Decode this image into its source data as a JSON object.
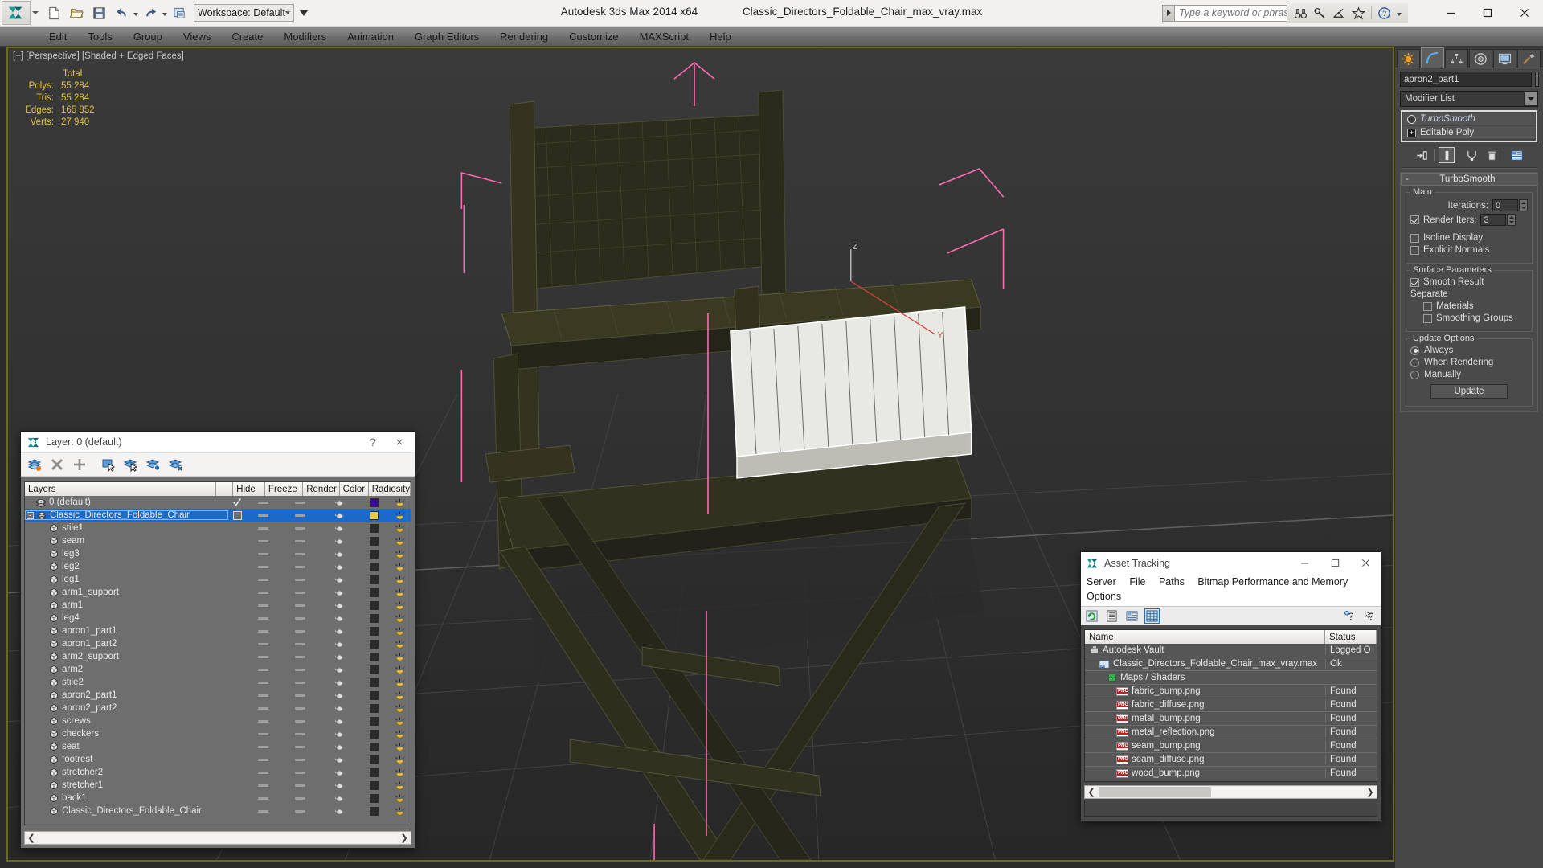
{
  "titlebar": {
    "workspace_label": "Workspace: Default",
    "product": "Autodesk 3ds Max  2014 x64",
    "filename": "Classic_Directors_Foldable_Chair_max_vray.max",
    "search_placeholder": "Type a keyword or phrase"
  },
  "menubar": {
    "items": [
      "Edit",
      "Tools",
      "Group",
      "Views",
      "Create",
      "Modifiers",
      "Animation",
      "Graph Editors",
      "Rendering",
      "Customize",
      "MAXScript",
      "Help"
    ]
  },
  "viewport": {
    "label": "[+] [Perspective] [Shaded + Edged Faces]",
    "stats": {
      "header": "Total",
      "rows": [
        {
          "key": "Polys:",
          "value": "55 284"
        },
        {
          "key": "Tris:",
          "value": "55 284"
        },
        {
          "key": "Edges:",
          "value": "165 852"
        },
        {
          "key": "Verts:",
          "value": "27 940"
        }
      ]
    }
  },
  "layer_dialog": {
    "title": "Layer: 0 (default)",
    "help_label": "?",
    "close_label": "×",
    "columns": [
      "Layers",
      "",
      "Hide",
      "Freeze",
      "Render",
      "Color",
      "Radiosity"
    ],
    "rows": [
      {
        "name": "0 (default)",
        "indent": 0,
        "icon": "layers-icon",
        "check": "tick",
        "color": "#3b0a9b",
        "selected": false
      },
      {
        "name": "Classic_Directors_Foldable_Chair",
        "indent": 0,
        "icon": "layers-icon",
        "check": "box",
        "color": "#e8c84a",
        "selected": true,
        "expander": "minus"
      },
      {
        "name": "stile1",
        "indent": 1,
        "icon": "object-icon",
        "color": "#2b2b2b",
        "selected": false
      },
      {
        "name": "seam",
        "indent": 1,
        "icon": "object-icon",
        "color": "#2b2b2b",
        "selected": false
      },
      {
        "name": "leg3",
        "indent": 1,
        "icon": "object-icon",
        "color": "#2b2b2b",
        "selected": false
      },
      {
        "name": "leg2",
        "indent": 1,
        "icon": "object-icon",
        "color": "#2b2b2b",
        "selected": false
      },
      {
        "name": "leg1",
        "indent": 1,
        "icon": "object-icon",
        "color": "#2b2b2b",
        "selected": false
      },
      {
        "name": "arm1_support",
        "indent": 1,
        "icon": "object-icon",
        "color": "#2b2b2b",
        "selected": false
      },
      {
        "name": "arm1",
        "indent": 1,
        "icon": "object-icon",
        "color": "#2b2b2b",
        "selected": false
      },
      {
        "name": "leg4",
        "indent": 1,
        "icon": "object-icon",
        "color": "#2b2b2b",
        "selected": false
      },
      {
        "name": "apron1_part1",
        "indent": 1,
        "icon": "object-icon",
        "color": "#2b2b2b",
        "selected": false
      },
      {
        "name": "apron1_part2",
        "indent": 1,
        "icon": "object-icon",
        "color": "#2b2b2b",
        "selected": false
      },
      {
        "name": "arm2_support",
        "indent": 1,
        "icon": "object-icon",
        "color": "#2b2b2b",
        "selected": false
      },
      {
        "name": "arm2",
        "indent": 1,
        "icon": "object-icon",
        "color": "#2b2b2b",
        "selected": false
      },
      {
        "name": "stile2",
        "indent": 1,
        "icon": "object-icon",
        "color": "#2b2b2b",
        "selected": false
      },
      {
        "name": "apron2_part1",
        "indent": 1,
        "icon": "object-icon",
        "color": "#2b2b2b",
        "selected": false
      },
      {
        "name": "apron2_part2",
        "indent": 1,
        "icon": "object-icon",
        "color": "#2b2b2b",
        "selected": false
      },
      {
        "name": "screws",
        "indent": 1,
        "icon": "object-icon",
        "color": "#2b2b2b",
        "selected": false
      },
      {
        "name": "checkers",
        "indent": 1,
        "icon": "object-icon",
        "color": "#2b2b2b",
        "selected": false
      },
      {
        "name": "seat",
        "indent": 1,
        "icon": "object-icon",
        "color": "#2b2b2b",
        "selected": false
      },
      {
        "name": "footrest",
        "indent": 1,
        "icon": "object-icon",
        "color": "#2b2b2b",
        "selected": false
      },
      {
        "name": "stretcher2",
        "indent": 1,
        "icon": "object-icon",
        "color": "#2b2b2b",
        "selected": false
      },
      {
        "name": "stretcher1",
        "indent": 1,
        "icon": "object-icon",
        "color": "#2b2b2b",
        "selected": false
      },
      {
        "name": "back1",
        "indent": 1,
        "icon": "object-icon",
        "color": "#2b2b2b",
        "selected": false
      },
      {
        "name": "Classic_Directors_Foldable_Chair",
        "indent": 1,
        "icon": "object-icon",
        "color": "#2b2b2b",
        "selected": false
      }
    ]
  },
  "asset_dialog": {
    "title": "Asset Tracking",
    "menu": [
      "Server",
      "File",
      "Paths",
      "Bitmap Performance and Memory",
      "Options"
    ],
    "columns": [
      "Name",
      "Status"
    ],
    "rows": [
      {
        "name": "Autodesk Vault",
        "status": "Logged O",
        "indent": 0,
        "icon": "vault-icon"
      },
      {
        "name": "Classic_Directors_Foldable_Chair_max_vray.max",
        "status": "Ok",
        "indent": 1,
        "icon": "max-file-icon"
      },
      {
        "name": "Maps / Shaders",
        "status": "",
        "indent": 2,
        "icon": "maps-icon"
      },
      {
        "name": "fabric_bump.png",
        "status": "Found",
        "indent": 3,
        "icon": "png-icon"
      },
      {
        "name": "fabric_diffuse.png",
        "status": "Found",
        "indent": 3,
        "icon": "png-icon"
      },
      {
        "name": "metal_bump.png",
        "status": "Found",
        "indent": 3,
        "icon": "png-icon"
      },
      {
        "name": "metal_reflection.png",
        "status": "Found",
        "indent": 3,
        "icon": "png-icon"
      },
      {
        "name": "seam_bump.png",
        "status": "Found",
        "indent": 3,
        "icon": "png-icon"
      },
      {
        "name": "seam_diffuse.png",
        "status": "Found",
        "indent": 3,
        "icon": "png-icon"
      },
      {
        "name": "wood_bump.png",
        "status": "Found",
        "indent": 3,
        "icon": "png-icon"
      }
    ]
  },
  "command_panel": {
    "object_name": "apron2_part1",
    "modifier_list_label": "Modifier List",
    "stack": [
      {
        "label": "TurboSmooth",
        "italic": true
      },
      {
        "label": "Editable Poly",
        "italic": false
      }
    ],
    "rollout_title": "TurboSmooth",
    "groups": {
      "main": {
        "title": "Main",
        "iterations_label": "Iterations:",
        "iterations_value": "0",
        "render_iters_label": "Render Iters:",
        "render_iters_value": "3",
        "render_iters_checked": true,
        "isoline_label": "Isoline Display",
        "isoline_checked": false,
        "explicit_label": "Explicit Normals",
        "explicit_checked": false
      },
      "surface": {
        "title": "Surface Parameters",
        "smooth_result_label": "Smooth Result",
        "smooth_result_checked": true,
        "separate_label": "Separate",
        "materials_label": "Materials",
        "materials_checked": false,
        "smoothing_groups_label": "Smoothing Groups",
        "smoothing_groups_checked": false
      },
      "update": {
        "title": "Update Options",
        "options": [
          {
            "label": "Always",
            "selected": true
          },
          {
            "label": "When Rendering",
            "selected": false
          },
          {
            "label": "Manually",
            "selected": false
          }
        ],
        "update_button": "Update"
      }
    }
  },
  "colors": {
    "viewport_bg": "#2e2e2e",
    "viewport_border": "#6b6b1f",
    "selection_blue": "#1b6ac7",
    "stat_yellow": "#e0c040",
    "gizmo_pink": "#ff6ab0"
  }
}
